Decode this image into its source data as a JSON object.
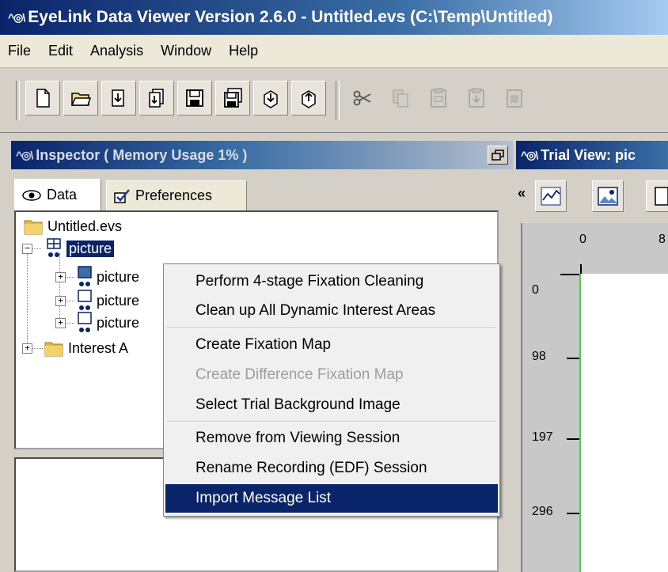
{
  "window": {
    "title": "EyeLink Data Viewer Version 2.6.0 - Untitled.evs (C:\\Temp\\Untitled)"
  },
  "menubar": {
    "items": [
      "File",
      "Edit",
      "Analysis",
      "Window",
      "Help"
    ]
  },
  "toolbar": {
    "buttons": [
      "new-file-icon",
      "open-folder-icon",
      "import-icon",
      "import-multiple-icon",
      "save-icon",
      "save-as-icon",
      "export-icon",
      "export-all-icon",
      "cut-icon",
      "copy-icon",
      "paste-icon",
      "paste-special-icon",
      "delete-icon"
    ]
  },
  "inspector": {
    "title": "Inspector ( Memory Usage 1% )",
    "tabs": [
      {
        "label": "Data",
        "active": true
      },
      {
        "label": "Preferences",
        "active": false
      }
    ],
    "tree": {
      "root": "Untitled.evs",
      "session": "picture",
      "trials": [
        "picture",
        "picture",
        "picture"
      ],
      "interest": "Interest A"
    }
  },
  "trial_view": {
    "title": "Trial View: pic",
    "chevron": "«",
    "x_ticks": [
      "0",
      "8"
    ],
    "y_ticks": [
      "0",
      "98",
      "197",
      "296"
    ]
  },
  "context_menu": {
    "items": [
      {
        "label": "Perform 4-stage Fixation Cleaning",
        "enabled": true
      },
      {
        "label": "Clean up All Dynamic Interest Areas",
        "enabled": true
      },
      {
        "label": "Create Fixation Map",
        "enabled": true
      },
      {
        "label": "Create Difference Fixation Map",
        "enabled": false
      },
      {
        "label": "Select Trial Background Image",
        "enabled": true
      },
      {
        "label": "Remove from Viewing Session",
        "enabled": true
      },
      {
        "label": "Rename Recording (EDF) Session",
        "enabled": true
      },
      {
        "label": "Import Message List",
        "enabled": true,
        "highlighted": true
      }
    ]
  },
  "colors": {
    "title_bar": "#0a246a",
    "selection": "#0a246a",
    "canvas_border": "#4ad04a"
  }
}
